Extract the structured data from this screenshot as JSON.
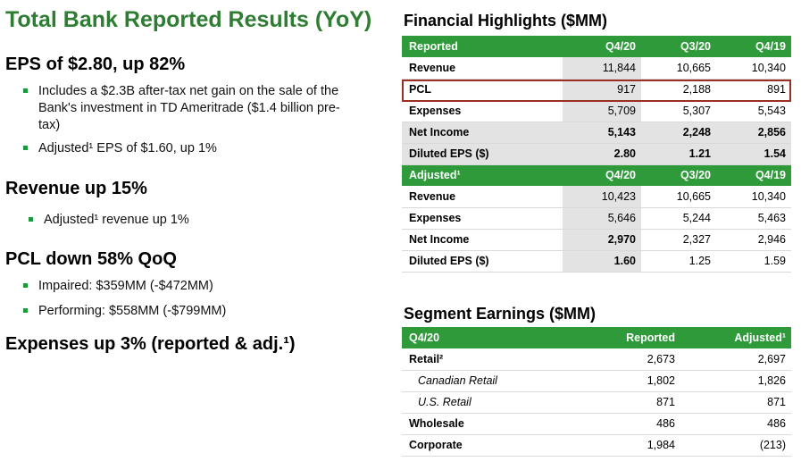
{
  "title": "Total Bank Reported Results (YoY)",
  "left": {
    "eps_heading": "EPS of $2.80, up 82%",
    "eps_bullets": [
      "Includes a $2.3B after-tax net gain on the sale of the Bank's investment in TD Ameritrade ($1.4 billion pre-tax)",
      "Adjusted¹ EPS of $1.60, up 1%"
    ],
    "revenue_heading": "Revenue up 15%",
    "revenue_bullets": [
      "Adjusted¹ revenue up 1%"
    ],
    "pcl_heading": "PCL down 58% QoQ",
    "pcl_bullets": [
      "Impaired: $359MM (-$472MM)",
      "Performing: $558MM (-$799MM)"
    ],
    "expenses_heading": "Expenses up 3% (reported & adj.¹)"
  },
  "highlights": {
    "title": "Financial Highlights ($MM)",
    "reported_header": [
      "Reported",
      "Q4/20",
      "Q3/20",
      "Q4/19"
    ],
    "reported_rows": [
      [
        "Revenue",
        "11,844",
        "10,665",
        "10,340"
      ],
      [
        "PCL",
        "917",
        "2,188",
        "891"
      ],
      [
        "Expenses",
        "5,709",
        "5,307",
        "5,543"
      ],
      [
        "Net Income",
        "5,143",
        "2,248",
        "2,856"
      ],
      [
        "Diluted EPS ($)",
        "2.80",
        "1.21",
        "1.54"
      ]
    ],
    "adjusted_header": [
      "Adjusted¹",
      "Q4/20",
      "Q3/20",
      "Q4/19"
    ],
    "adjusted_rows": [
      [
        "Revenue",
        "10,423",
        "10,665",
        "10,340"
      ],
      [
        "Expenses",
        "5,646",
        "5,244",
        "5,463"
      ],
      [
        "Net Income",
        "2,970",
        "2,327",
        "2,946"
      ],
      [
        "Diluted EPS ($)",
        "1.60",
        "1.25",
        "1.59"
      ]
    ]
  },
  "segment": {
    "title": "Segment Earnings ($MM)",
    "header": [
      "Q4/20",
      "Reported",
      "Adjusted¹"
    ],
    "rows": [
      [
        "Retail²",
        "2,673",
        "2,697"
      ],
      [
        "Canadian Retail",
        "1,802",
        "1,826"
      ],
      [
        "U.S. Retail",
        "871",
        "871"
      ],
      [
        "Wholesale",
        "486",
        "486"
      ],
      [
        "Corporate",
        "1,984",
        "(213)"
      ]
    ]
  }
}
